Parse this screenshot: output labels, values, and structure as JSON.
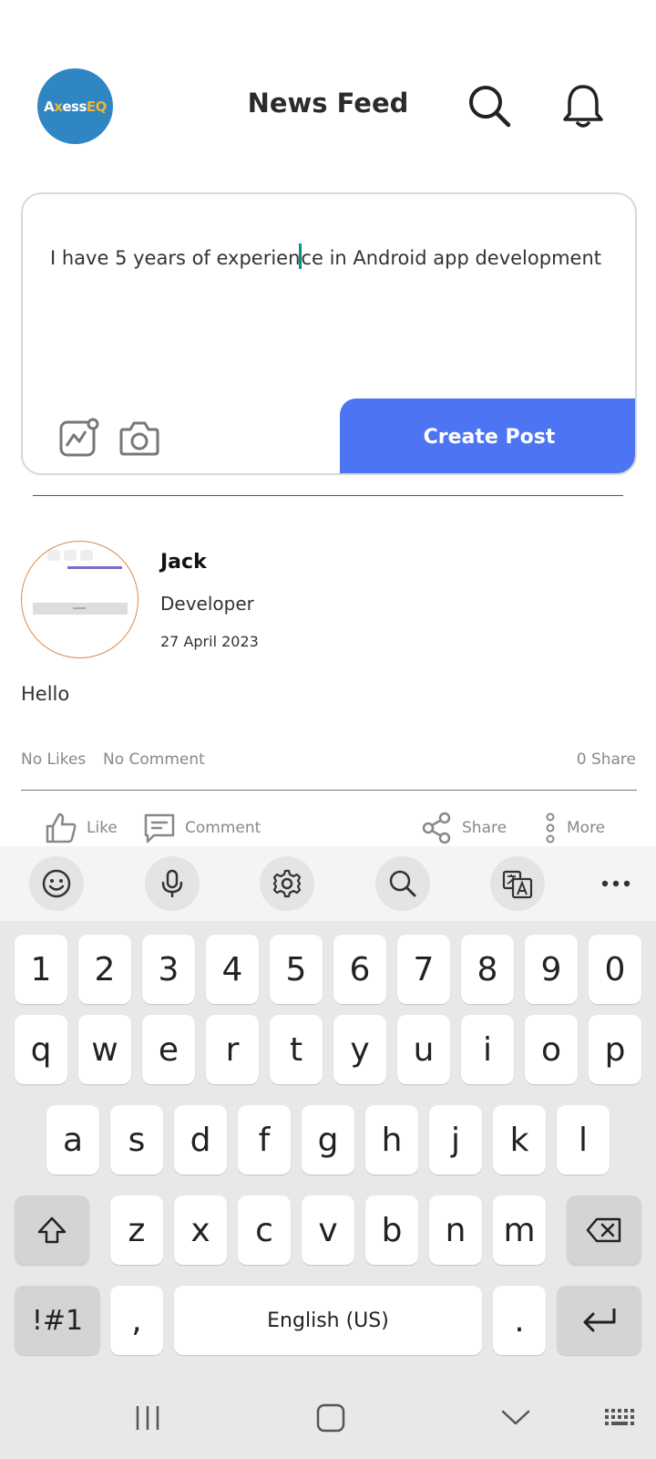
{
  "header": {
    "logo_text_white_a": "A",
    "logo_text_yellow_x": "x",
    "logo_text_white_ess": "ess",
    "logo_text_yellow_eq": "EQ",
    "title": "News Feed",
    "search_icon": "search-icon",
    "bell_icon": "bell-icon"
  },
  "composer": {
    "text_before_cursor": "I have 5 years of experien",
    "text_after_cursor": "ce in Android app development",
    "gallery_icon": "gallery-icon",
    "camera_icon": "camera-icon",
    "create_post_label": "Create Post",
    "accent_color": "#4d74f2"
  },
  "post": {
    "author": "Jack",
    "role": "Developer",
    "date": "27 April 2023",
    "body": "Hello",
    "likes": "No Likes",
    "comments": "No Comment",
    "shares": "0 Share",
    "actions": {
      "like": "Like",
      "comment": "Comment",
      "share": "Share",
      "more": "More"
    }
  },
  "keyboard": {
    "toolbar_icons": [
      "emoji-icon",
      "mic-icon",
      "settings-icon",
      "search-icon",
      "translate-icon",
      "more-icon"
    ],
    "row_numbers": [
      "1",
      "2",
      "3",
      "4",
      "5",
      "6",
      "7",
      "8",
      "9",
      "0"
    ],
    "row1": [
      "q",
      "w",
      "e",
      "r",
      "t",
      "y",
      "u",
      "i",
      "o",
      "p"
    ],
    "row2": [
      "a",
      "s",
      "d",
      "f",
      "g",
      "h",
      "j",
      "k",
      "l"
    ],
    "row3": [
      "z",
      "x",
      "c",
      "v",
      "b",
      "n",
      "m"
    ],
    "symbols_key": "!#1",
    "comma_key": ",",
    "space_label": "English (US)",
    "period_key": "."
  },
  "navbar": {
    "icons": [
      "recents-icon",
      "home-icon",
      "back-icon",
      "keyboard-switch-icon"
    ]
  }
}
